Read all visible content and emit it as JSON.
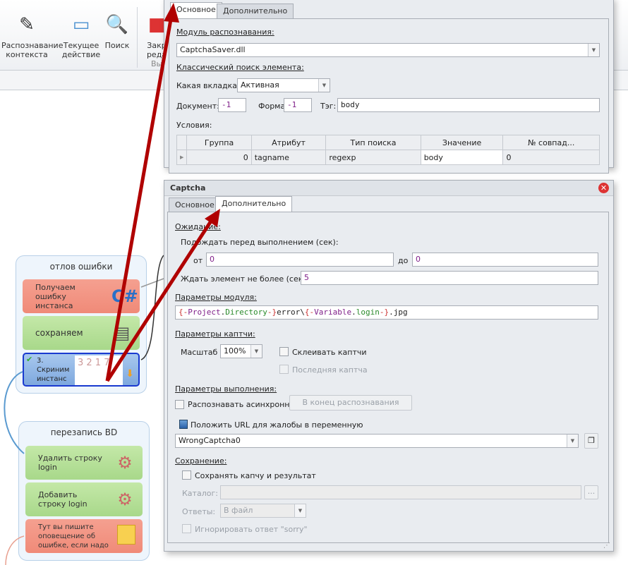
{
  "ribbon": {
    "items": [
      {
        "label": "Распознавание контекста",
        "icon": "context-recognition-icon"
      },
      {
        "label": "Текущее действие",
        "icon": "current-action-icon"
      },
      {
        "label": "Поиск",
        "icon": "search-icon"
      },
      {
        "label": "Закр реда",
        "icon": "close-editor-icon"
      }
    ],
    "group_label": "Вы"
  },
  "dialog_top": {
    "tabs": [
      "Основное",
      "Дополнительно"
    ],
    "active_tab": "Основное",
    "module_section": "Модуль распознавания:",
    "module_value": "CaptchaSaver.dll",
    "classic_section": "Классический поиск элемента:",
    "tab_label": "Какая вкладка:",
    "tab_value": "Активная",
    "doc_label": "Документ:",
    "doc_value": "-1",
    "form_label": "Форма:",
    "form_value": "-1",
    "tag_label": "Тэг:",
    "tag_value": "body",
    "conditions_label": "Условия:",
    "table": {
      "columns": [
        "Группа",
        "Атрибут",
        "Тип поиска",
        "Значение",
        "№ совпад..."
      ],
      "rows": [
        [
          "0",
          "tagname",
          "regexp",
          "body",
          "0"
        ]
      ]
    }
  },
  "dialog": {
    "title": "Captcha",
    "tabs": [
      "Основное",
      "Дополнительно"
    ],
    "active_tab": "Дополнительно",
    "wait_section": "Ожидание:",
    "wait_before_label": "Подождать перед выполнением (сек):",
    "from_label": "от",
    "from_value": "0",
    "to_label": "до",
    "to_value": "0",
    "wait_element_label": "Ждать элемент не более (сек):",
    "wait_element_value": "5",
    "module_params_section": "Параметры модуля:",
    "module_path": {
      "p1": "{-",
      "p2": "Project",
      "p3": ".",
      "p4": "Directory",
      "p5": "-}",
      "p6": "error\\",
      "p7": "{-",
      "p8": "Variable",
      "p9": ".",
      "p10": "login",
      "p11": "-}",
      "p12": ".jpg"
    },
    "captcha_section": "Параметры каптчи:",
    "scale_label": "Масштаб",
    "scale_value": "100%",
    "glue_label": "Склеивать каптчи",
    "glue_checked": false,
    "last_label": "Последняя каптча",
    "last_checked": false,
    "exec_section": "Параметры выполнения:",
    "async_label": "Распознавать асинхронно",
    "async_checked": false,
    "end_button": "В конец распознавания",
    "url_label": "Положить URL для жалобы в переменную",
    "url_var": "WrongCaptcha0",
    "save_section": "Сохранение:",
    "save_label": "Сохранять капчу и результат",
    "save_checked": false,
    "catalog_label": "Каталог:",
    "catalog_value": "",
    "browse_label": "...",
    "answers_label": "Ответы:",
    "answers_value": "В файл",
    "ignore_label": "Игнорировать ответ \"sorry\"",
    "ignore_checked": false
  },
  "flow": {
    "groups": [
      {
        "title": "отлов ошибки",
        "blocks": [
          {
            "label": "Получаем ошибку инстанса",
            "color": "red",
            "icon": "csharp-icon"
          },
          {
            "label": "сохраняем",
            "color": "green",
            "icon": "document-icon"
          },
          {
            "label": "3. Скриним инстанс",
            "color": "blue",
            "icon": "captcha-icon"
          }
        ]
      },
      {
        "title": "перезапись BD",
        "blocks": [
          {
            "label": "Удалить строку login",
            "color": "green",
            "icon": "gear-icon"
          },
          {
            "label": "Добавить строку login",
            "color": "green",
            "icon": "gear-icon"
          },
          {
            "label": "Тут вы пишите оповещение об ошибке, если надо",
            "color": "red",
            "icon": "sticky-note-icon"
          }
        ]
      }
    ]
  },
  "colors": {
    "arrow": "#b00000",
    "accent_blue": "#1a3ad0",
    "number": "#80208a"
  }
}
